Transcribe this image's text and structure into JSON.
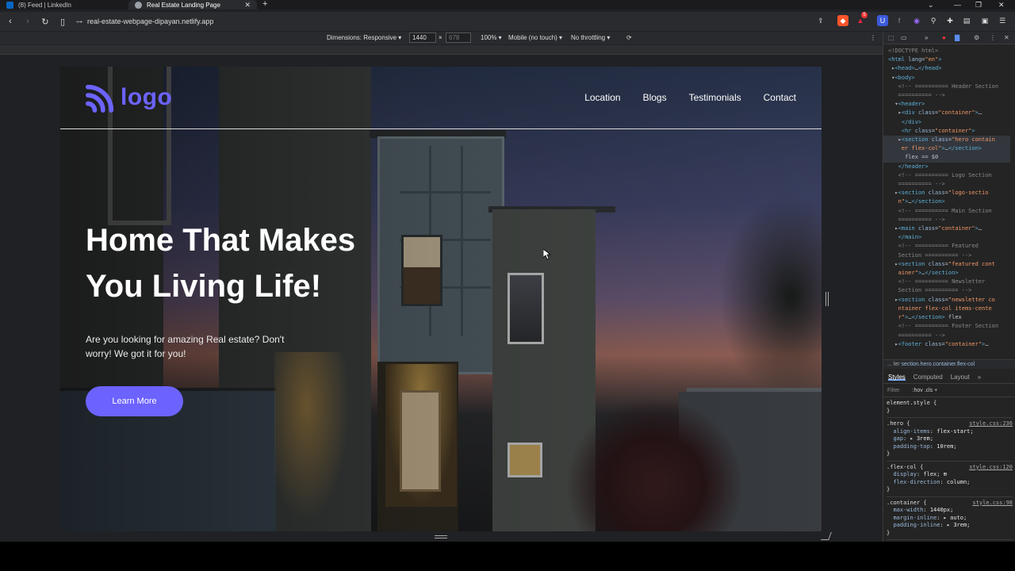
{
  "browser": {
    "tabs": [
      {
        "title": "(8) Feed | LinkedIn",
        "favicon_color": "#0a66c2"
      },
      {
        "title": "Real Estate Landing Page",
        "favicon_color": "#9aa0a6"
      }
    ],
    "url": "real-estate-webpage-dipayan.netlify.app",
    "new_tab_label": "+",
    "extension_badge": "5"
  },
  "device_toolbar": {
    "dimensions_label": "Dimensions: Responsive ▾",
    "width": "1440",
    "times": "×",
    "height_placeholder": "678",
    "zoom": "100% ▾",
    "touch": "Mobile (no touch) ▾",
    "throttle": "No throttling ▾"
  },
  "site": {
    "logo_text": "logo",
    "nav": [
      "Location",
      "Blogs",
      "Testimonials",
      "Contact"
    ],
    "hero_title": "Home That Makes You Living Life!",
    "hero_subtitle": "Are you looking for amazing Real estate? Don't worry! We got it for you!",
    "cta": "Learn More",
    "accent_color": "#6c63ff"
  },
  "devtools": {
    "crumb_left": "... ler",
    "crumb": "section.hero.container.flex-col",
    "tabs": [
      "Styles",
      "Computed",
      "Layout",
      "»"
    ],
    "filter_placeholder": "Filter",
    "filter_tools": ":hov  .cls  +"
  }
}
